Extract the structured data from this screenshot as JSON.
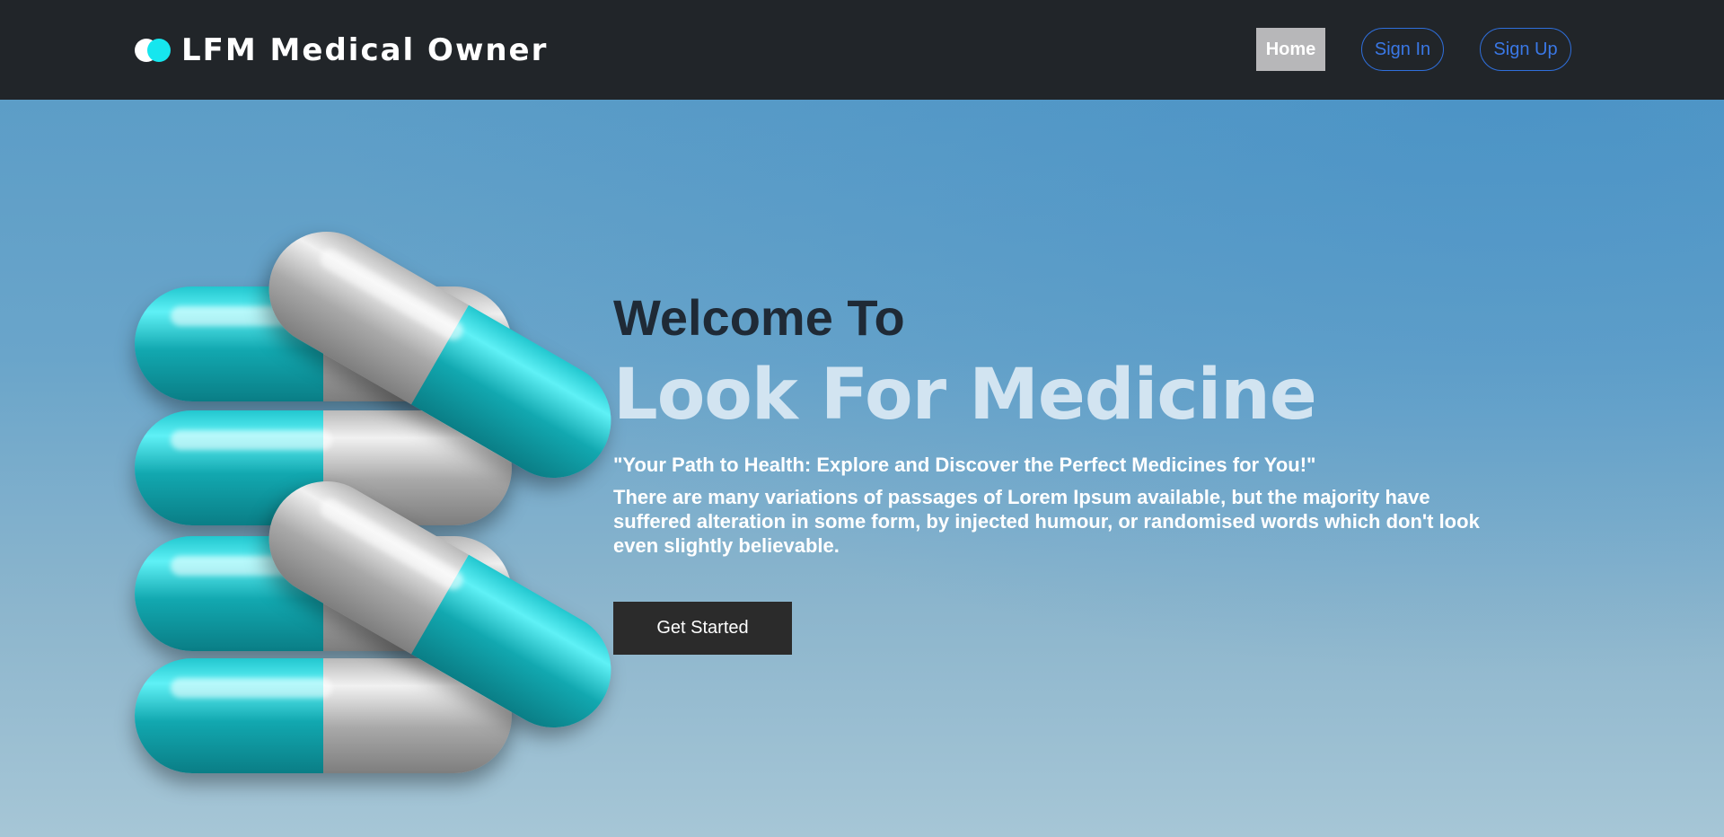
{
  "header": {
    "brand": "LFM Medical Owner",
    "nav": {
      "home": "Home",
      "sign_in": "Sign In",
      "sign_up": "Sign Up"
    }
  },
  "hero": {
    "welcome": "Welcome To",
    "title": "Look For Medicine",
    "tagline": "\"Your Path to Health: Explore and Discover the Perfect Medicines for You!\"",
    "description": "There are many variations of passages of Lorem Ipsum available, but the majority have suffered alteration in some form, by injected humour, or randomised words which don't look even slightly believable.",
    "cta": "Get Started"
  },
  "colors": {
    "navbar": "#212529",
    "accent_cyan": "#16e6ee",
    "link_blue": "#3a78e6",
    "cta_bg": "#2b2b2b"
  }
}
